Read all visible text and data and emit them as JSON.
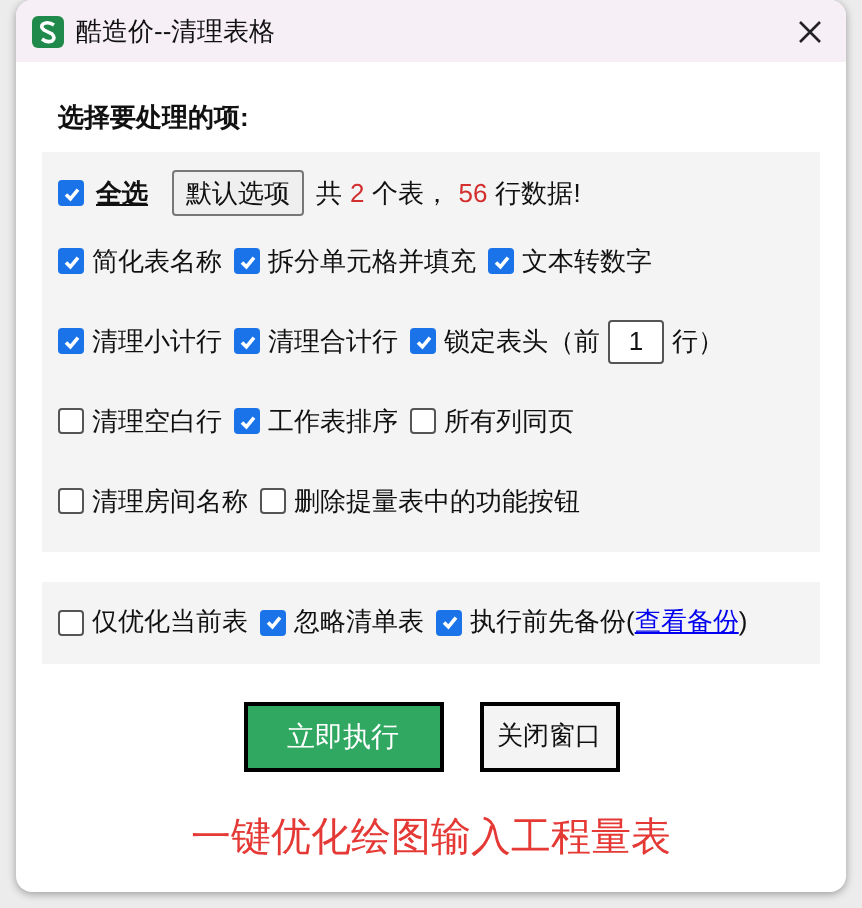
{
  "window": {
    "title": "酷造价--清理表格"
  },
  "heading": "选择要处理的项:",
  "select_all": {
    "label": "全选",
    "checked": true
  },
  "default_button": "默认选项",
  "summary": [
    {
      "kind": "text",
      "text": "共"
    },
    {
      "kind": "count",
      "text": "2"
    },
    {
      "kind": "text",
      "text": "个表，"
    },
    {
      "kind": "count",
      "text": "56"
    },
    {
      "kind": "text",
      "text": "行数据!"
    }
  ],
  "option_rows": [
    [
      {
        "kind": "checkbox",
        "label": "简化表名称",
        "checked": true
      },
      {
        "kind": "checkbox",
        "label": "拆分单元格并填充",
        "checked": true
      },
      {
        "kind": "checkbox",
        "label": "文本转数字",
        "checked": true
      }
    ],
    [
      {
        "kind": "checkbox",
        "label": "清理小计行",
        "checked": true
      },
      {
        "kind": "checkbox",
        "label": "清理合计行",
        "checked": true
      },
      {
        "kind": "input",
        "label": "锁定表头（前",
        "value": "1",
        "suffix": "行）",
        "checked": true
      }
    ],
    [
      {
        "kind": "checkbox",
        "label": "清理空白行",
        "checked": false
      },
      {
        "kind": "checkbox",
        "label": "工作表排序",
        "checked": true
      },
      {
        "kind": "checkbox",
        "label": "所有列同页",
        "checked": false
      }
    ],
    [
      {
        "kind": "checkbox",
        "label": "清理房间名称",
        "checked": false
      },
      {
        "kind": "checkbox",
        "label": "删除提量表中的功能按钮",
        "checked": false
      }
    ]
  ],
  "bottom_options": [
    {
      "kind": "checkbox",
      "label": "仅优化当前表",
      "checked": false
    },
    {
      "kind": "checkbox",
      "label": "忽略清单表",
      "checked": true
    },
    {
      "kind": "link",
      "label": "执行前先备份(",
      "link": "查看备份",
      "suffix": ")",
      "checked": true
    }
  ],
  "buttons": {
    "run": "立即执行",
    "close": "关闭窗口"
  },
  "footer": "一键优化绘图输入工程量表"
}
